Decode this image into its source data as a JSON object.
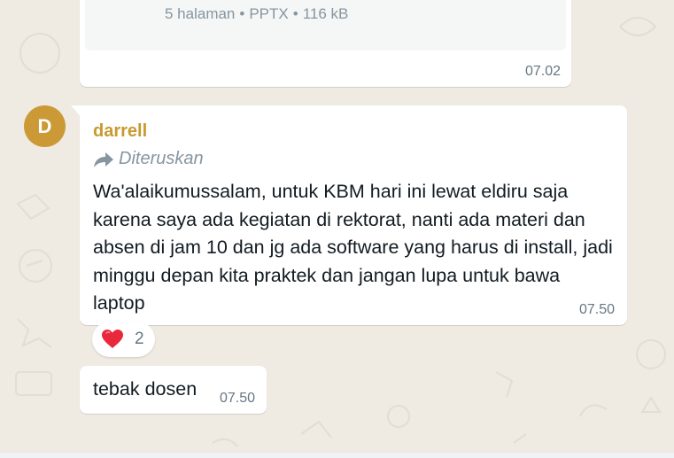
{
  "colors": {
    "chat_background": "#efeae2",
    "bubble": "#ffffff",
    "sender_name": "#c89a2e",
    "avatar": "#cb9a36",
    "meta_text": "#8696a0",
    "time_text": "#667781",
    "heart": "#e8293b"
  },
  "file_message": {
    "pages": "5 halaman",
    "type": "PPTX",
    "size": "116 kB",
    "separator": "•",
    "time": "07.02"
  },
  "avatar": {
    "initial": "D"
  },
  "message": {
    "sender": "darrell",
    "forwarded_icon": "forward-arrow-icon",
    "forwarded_label": "Diteruskan",
    "text": "Wa'alaikumussalam, untuk KBM hari ini lewat eldiru saja karena saya ada kegiatan di rektorat, nanti ada materi dan absen di jam 10 dan jg ada software yang harus di install, jadi minggu depan kita praktek dan jangan lupa untuk bawa laptop",
    "time": "07.50"
  },
  "reaction": {
    "icon": "heart-icon",
    "count": "2"
  },
  "second_message": {
    "text": "tebak dosen",
    "time": "07.50"
  }
}
